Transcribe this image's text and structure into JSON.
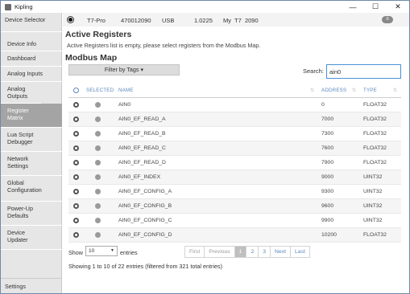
{
  "window": {
    "title": "Kipling",
    "minimize": "—",
    "maximize": "☐",
    "close": "✕"
  },
  "sidebar": {
    "items": [
      {
        "label": "Device Selector"
      },
      {
        "label": "Device Info"
      },
      {
        "label": "Dashboard"
      },
      {
        "label": "Analog Inputs"
      },
      {
        "label": "Analog Outputs"
      },
      {
        "label": "Register Matrix"
      },
      {
        "label": "Lua Script Debugger"
      },
      {
        "label": "Network Settings"
      },
      {
        "label": "Global Configuration"
      },
      {
        "label": "Power-Up Defaults"
      },
      {
        "label": "Device Updater"
      }
    ],
    "settings": "Settings"
  },
  "device": {
    "model": "T7-Pro",
    "serial": "470012090",
    "connection": "USB",
    "firmware": "1.0225",
    "name": "My  T7  2090",
    "badge": "0"
  },
  "active_registers": {
    "heading": "Active Registers",
    "message": "Active Registers list is empty, please select registers from the Modbus Map."
  },
  "modbus_map": {
    "heading": "Modbus Map",
    "filter_label": "Filter by Tags ▾",
    "search_label": "Search:",
    "search_value": "ain0",
    "columns": [
      "SELECTED",
      "NAME",
      "ADDRESS",
      "TYPE"
    ],
    "rows": [
      {
        "name": "AIN0",
        "address": "0",
        "type": "FLOAT32"
      },
      {
        "name": "AIN0_EF_READ_A",
        "address": "7000",
        "type": "FLOAT32"
      },
      {
        "name": "AIN0_EF_READ_B",
        "address": "7300",
        "type": "FLOAT32"
      },
      {
        "name": "AIN0_EF_READ_C",
        "address": "7600",
        "type": "FLOAT32"
      },
      {
        "name": "AIN0_EF_READ_D",
        "address": "7900",
        "type": "FLOAT32"
      },
      {
        "name": "AIN0_EF_INDEX",
        "address": "9000",
        "type": "UINT32"
      },
      {
        "name": "AIN0_EF_CONFIG_A",
        "address": "9300",
        "type": "UINT32"
      },
      {
        "name": "AIN0_EF_CONFIG_B",
        "address": "9600",
        "type": "UINT32"
      },
      {
        "name": "AIN0_EF_CONFIG_C",
        "address": "9900",
        "type": "UINT32"
      },
      {
        "name": "AIN0_EF_CONFIG_D",
        "address": "10200",
        "type": "FLOAT32"
      }
    ],
    "show_label": "Show",
    "page_size": "10",
    "entries_label": "entries",
    "pagination": [
      "First",
      "Previous",
      "1",
      "2",
      "3",
      "Next",
      "Last"
    ],
    "current_page": "1",
    "summary": "Showing 1 to 10 of 22 entries (filtered from 321 total entries)"
  }
}
